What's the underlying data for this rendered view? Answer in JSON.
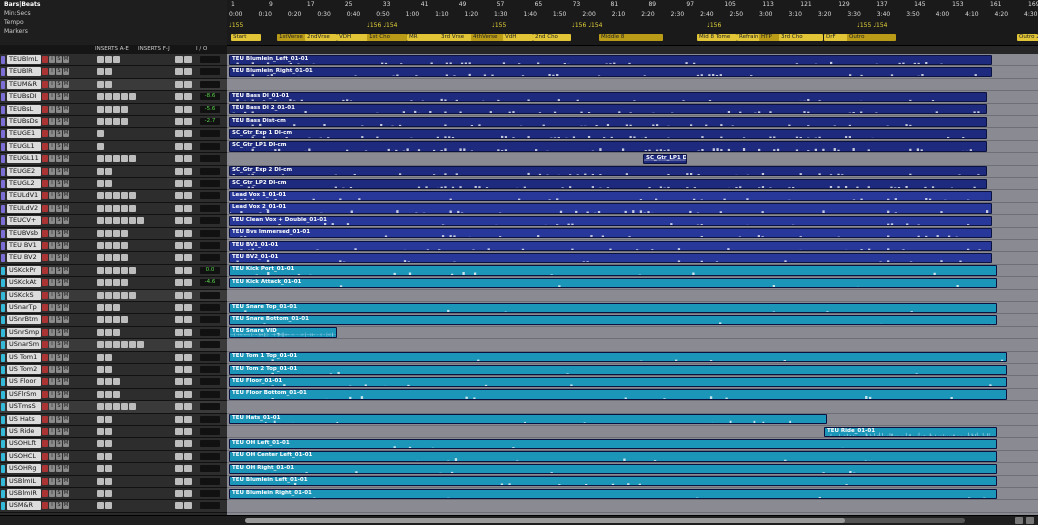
{
  "ruler": {
    "rows": [
      {
        "label": "Bars|Beats",
        "key": "bars"
      },
      {
        "label": "Min:Secs",
        "key": "minsecs"
      },
      {
        "label": "Tempo",
        "key": "tempo"
      },
      {
        "label": "Markers",
        "key": "markers"
      }
    ],
    "bars": [
      "1",
      "9",
      "17",
      "25",
      "33",
      "41",
      "49",
      "57",
      "65",
      "73",
      "81",
      "89",
      "97",
      "105",
      "113",
      "121",
      "129",
      "137",
      "145",
      "153",
      "161",
      "169"
    ],
    "minsecs": [
      "0:00",
      "0:10",
      "0:20",
      "0:30",
      "0:40",
      "0:50",
      "1:00",
      "1:10",
      "1:20",
      "1:30",
      "1:40",
      "1:50",
      "2:00",
      "2:10",
      "2:20",
      "2:30",
      "2:40",
      "2:50",
      "3:00",
      "3:10",
      "3:20",
      "3:30",
      "3:40",
      "3:50",
      "4:00",
      "4:10",
      "4:20",
      "4:30"
    ],
    "tempos": [
      "♩155",
      "♩156 ♩154",
      "♩155",
      "♩156 ♩154",
      "♩156",
      "♩155 ♩154"
    ],
    "markers": [
      {
        "label": "Start"
      },
      {
        "label": "1stVerse"
      },
      {
        "label": "2ndVrse"
      },
      {
        "label": "VDH"
      },
      {
        "label": "1st Cho"
      },
      {
        "label": "MR"
      },
      {
        "label": "3rd Vrse"
      },
      {
        "label": "4thVerse"
      },
      {
        "label": "VdH"
      },
      {
        "label": "2nd Cho"
      },
      {
        "label": "Middle 8"
      },
      {
        "label": "Mid 8 Tome"
      },
      {
        "label": "Refrain"
      },
      {
        "label": "HTP"
      },
      {
        "label": "3rd Cho"
      },
      {
        "label": "DrF"
      },
      {
        "label": "Outro"
      },
      {
        "label": "Outro 2"
      }
    ]
  },
  "columns": {
    "inserts_ae": "INSERTS A-E",
    "inserts_fj": "INSERTS F-J",
    "io": "I / O"
  },
  "buttons": {
    "input": "I",
    "solo": "S",
    "mute": "M"
  },
  "tracks": [
    {
      "name": "TEUBlmL",
      "color": "#7b6fd6",
      "vol": ""
    },
    {
      "name": "TEUBlR",
      "color": "#7b6fd6",
      "vol": ""
    },
    {
      "name": "TEUM&R",
      "color": "#7b6fd6",
      "vol": ""
    },
    {
      "name": "TEUBsDI",
      "color": "#7b6fd6",
      "vol": "-8.6"
    },
    {
      "name": "TEUBsL",
      "color": "#7b6fd6",
      "vol": "-5.6"
    },
    {
      "name": "TEUBsDs",
      "color": "#7b6fd6",
      "vol": "-2.7"
    },
    {
      "name": "TEUGE1",
      "color": "#7b6fd6",
      "vol": ""
    },
    {
      "name": "TEUGL1",
      "color": "#7b6fd6",
      "vol": ""
    },
    {
      "name": "TEUGL11",
      "color": "#7b6fd6",
      "vol": ""
    },
    {
      "name": "TEUGE2",
      "color": "#7b6fd6",
      "vol": ""
    },
    {
      "name": "TEUGL2",
      "color": "#7b6fd6",
      "vol": ""
    },
    {
      "name": "TEULdV1",
      "color": "#7b6fd6",
      "vol": ""
    },
    {
      "name": "TEULdV2",
      "color": "#7b6fd6",
      "vol": ""
    },
    {
      "name": "TEUCV+",
      "color": "#7b6fd6",
      "vol": ""
    },
    {
      "name": "TEUBVsb",
      "color": "#7b6fd6",
      "vol": ""
    },
    {
      "name": "TEU BV1",
      "color": "#7b6fd6",
      "vol": ""
    },
    {
      "name": "TEU BV2",
      "color": "#7b6fd6",
      "vol": ""
    },
    {
      "name": "USKckPr",
      "color": "#34b9d8",
      "vol": "0.0"
    },
    {
      "name": "USKckAt",
      "color": "#34b9d8",
      "vol": "-4.6"
    },
    {
      "name": "USKckS",
      "color": "#34b9d8",
      "vol": ""
    },
    {
      "name": "USnarTp",
      "color": "#34b9d8",
      "vol": ""
    },
    {
      "name": "USnrBtm",
      "color": "#34b9d8",
      "vol": ""
    },
    {
      "name": "USnrSmp",
      "color": "#34b9d8",
      "vol": ""
    },
    {
      "name": "USnarSm",
      "color": "#34b9d8",
      "vol": ""
    },
    {
      "name": "US Tom1",
      "color": "#34b9d8",
      "vol": ""
    },
    {
      "name": "US Tom2",
      "color": "#34b9d8",
      "vol": ""
    },
    {
      "name": "US Floor",
      "color": "#34b9d8",
      "vol": ""
    },
    {
      "name": "USFlrSm",
      "color": "#34b9d8",
      "vol": ""
    },
    {
      "name": "USTmsS",
      "color": "#34b9d8",
      "vol": ""
    },
    {
      "name": "US Hats",
      "color": "#34b9d8",
      "vol": ""
    },
    {
      "name": "US Ride",
      "color": "#34b9d8",
      "vol": ""
    },
    {
      "name": "USOHLft",
      "color": "#34b9d8",
      "vol": ""
    },
    {
      "name": "USOHCL",
      "color": "#34b9d8",
      "vol": ""
    },
    {
      "name": "USOHRg",
      "color": "#34b9d8",
      "vol": ""
    },
    {
      "name": "USBlmIL",
      "color": "#34b9d8",
      "vol": ""
    },
    {
      "name": "USBlmIR",
      "color": "#34b9d8",
      "vol": ""
    },
    {
      "name": "USM&R",
      "color": "#34b9d8",
      "vol": ""
    }
  ],
  "clips": [
    {
      "track": 0,
      "label": "TEU Blumlein_Left_01-01",
      "kind": "blue"
    },
    {
      "track": 1,
      "label": "TEU Blumlein_Right_01-01",
      "kind": "blue"
    },
    {
      "track": 3,
      "label": "TEU Bass DI_01-01",
      "kind": "blue"
    },
    {
      "track": 4,
      "label": "TEU Bass DI 2_01-01",
      "kind": "blue"
    },
    {
      "track": 5,
      "label": "TEU Bass Dist-cm",
      "kind": "blue"
    },
    {
      "track": 6,
      "label": "SC_Gtr_Exp 1 DI-cm",
      "kind": "blue"
    },
    {
      "track": 7,
      "label": "SC_Gtr_LP1 DI-cm",
      "kind": "blue"
    },
    {
      "track": 8,
      "label": "SC_Gtr_LP1 DI-c",
      "kind": "blue"
    },
    {
      "track": 9,
      "label": "SC_Gtr_Exp 2 DI-cm",
      "kind": "blue"
    },
    {
      "track": 10,
      "label": "SC_Gtr_LP2 DI-cm",
      "kind": "blue"
    },
    {
      "track": 11,
      "label": "Lead Vox 1_01-01",
      "kind": "blue2"
    },
    {
      "track": 12,
      "label": "Lead Vox 2_01-01",
      "kind": "blue2"
    },
    {
      "track": 13,
      "label": "TEU Clean Vox + Double_01-01",
      "kind": "blue2"
    },
    {
      "track": 14,
      "label": "TEU Bvs Immersed_01-01",
      "kind": "blue2"
    },
    {
      "track": 15,
      "label": "TEU BV1_01-01",
      "kind": "blue2"
    },
    {
      "track": 16,
      "label": "TEU BV2_01-01",
      "kind": "blue2"
    },
    {
      "track": 17,
      "label": "TEU Kick Port_01-01",
      "kind": "cyan"
    },
    {
      "track": 18,
      "label": "TEU Kick Attack_01-01",
      "kind": "cyan"
    },
    {
      "track": 20,
      "label": "TEU Snare Top_01-01",
      "kind": "cyan"
    },
    {
      "track": 21,
      "label": "TEU Snare Bottom_01-01",
      "kind": "cyan"
    },
    {
      "track": 22,
      "label": "TEU Snare VID_",
      "kind": "cyan"
    },
    {
      "track": 24,
      "label": "TEU Tom 1 Top_01-01",
      "kind": "cyan"
    },
    {
      "track": 25,
      "label": "TEU Tom 2 Top_01-01",
      "kind": "cyan"
    },
    {
      "track": 26,
      "label": "TEU Floor_01-01",
      "kind": "cyan"
    },
    {
      "track": 27,
      "label": "TEU Floor Bottom_01-01",
      "kind": "cyan"
    },
    {
      "track": 29,
      "label": "TEU Hats_01-01",
      "kind": "cyan"
    },
    {
      "track": 30,
      "label": "TEU Ride_01-01",
      "kind": "cyan"
    },
    {
      "track": 31,
      "label": "TEU OH Left_01-01",
      "kind": "cyan"
    },
    {
      "track": 32,
      "label": "TEU OH Center Left_01-01",
      "kind": "cyan"
    },
    {
      "track": 33,
      "label": "TEU OH Right_01-01",
      "kind": "cyan"
    },
    {
      "track": 34,
      "label": "TEU Blumlein Left_01-01",
      "kind": "cyan"
    },
    {
      "track": 35,
      "label": "TEU Blumlein Right_01-01",
      "kind": "cyan"
    }
  ],
  "colors": {
    "audio_blue": "#1d2a7d",
    "vocal_blue": "#27389a",
    "drum_cyan": "#1b96b9",
    "marker_yellow": "#e1c536",
    "tempo_yellow": "#e6d23a"
  }
}
